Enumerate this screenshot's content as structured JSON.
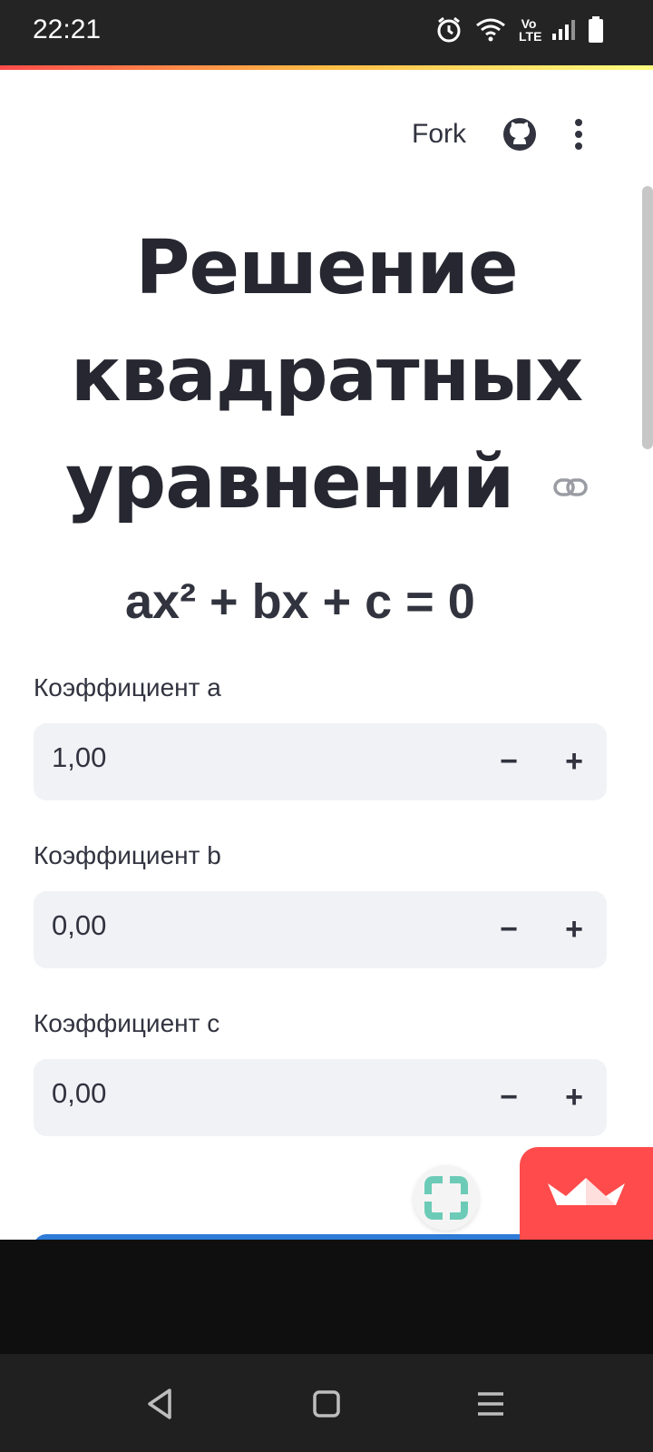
{
  "status_bar": {
    "time": "22:21",
    "icons": [
      "alarm-icon",
      "wifi-icon",
      "volte-icon",
      "signal-icon",
      "battery-icon"
    ],
    "volte_text": "Vo LTE"
  },
  "header": {
    "fork_label": "Fork",
    "github_icon": "github-icon",
    "menu_icon": "kebab-menu-icon"
  },
  "main": {
    "title": "Решение квадратных уравнений",
    "equation": "ax² + bx + c = 0",
    "fields": [
      {
        "label": "Коэффициент a",
        "value": "1,00"
      },
      {
        "label": "Коэффициент b",
        "value": "0,00"
      },
      {
        "label": "Коэффициент c",
        "value": "0,00"
      }
    ],
    "step_minus": "−",
    "step_plus": "+"
  },
  "colors": {
    "accent_red": "#ff4b4b",
    "text_dark": "#262730",
    "field_bg": "#f0f2f6",
    "button_blue": "#2f7bd8",
    "fab_teal": "#6ccbb7"
  },
  "nav": {
    "back_icon": "back-triangle-icon",
    "home_icon": "home-square-icon",
    "recents_icon": "recents-menu-icon"
  }
}
